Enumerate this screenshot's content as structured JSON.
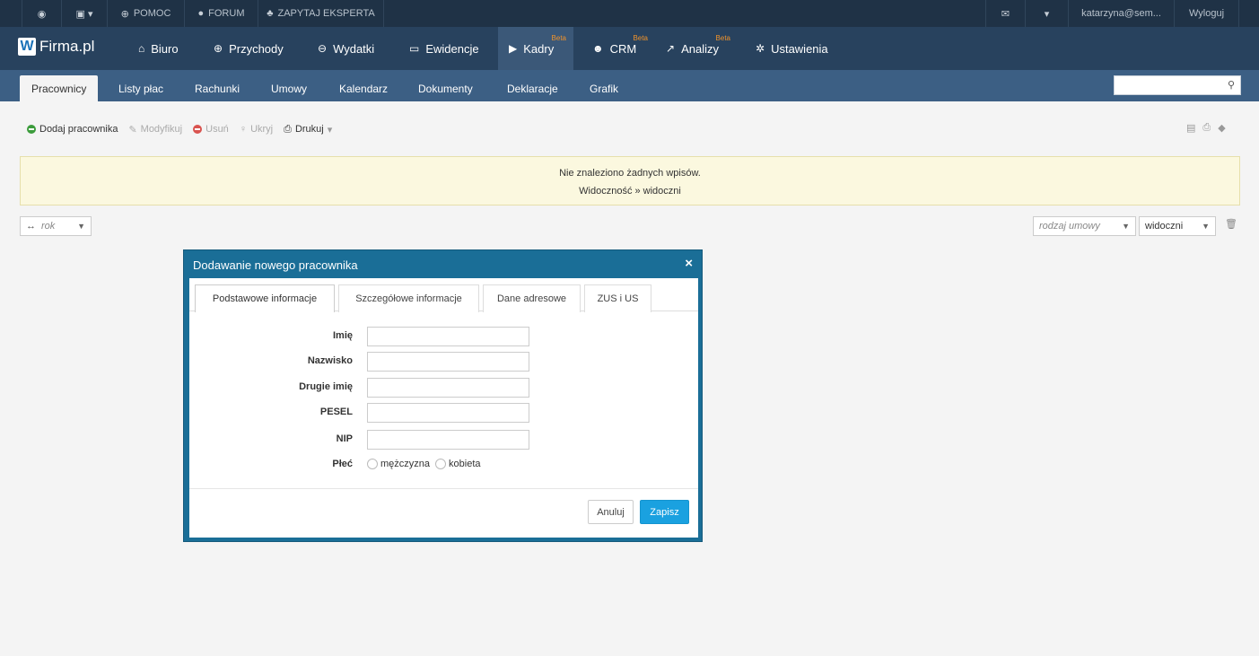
{
  "topbar": {
    "items": [
      {
        "icon": "globe-icon",
        "glyph": "◉",
        "label": ""
      },
      {
        "icon": "image-icon",
        "glyph": "▣ ▾",
        "label": ""
      },
      {
        "icon": "lifebuoy-icon",
        "glyph": "⊕",
        "label": "POMOC"
      },
      {
        "icon": "chat-icon",
        "glyph": "●",
        "label": "FORUM"
      },
      {
        "icon": "sitemap-icon",
        "glyph": "♣",
        "label": "ZAPYTAJ EKSPERTA"
      }
    ],
    "mail_glyph": "✉",
    "dropdown_glyph": "▾",
    "user": "katarzyna@sem...",
    "logout": "Wyloguj"
  },
  "brand": {
    "letter": "W",
    "name": "Firma.pl"
  },
  "mainnav": [
    {
      "label": "Biuro",
      "glyph": "⌂"
    },
    {
      "label": "Przychody",
      "glyph": "⊕"
    },
    {
      "label": "Wydatki",
      "glyph": "⊖"
    },
    {
      "label": "Ewidencje",
      "glyph": "▭"
    },
    {
      "label": "Kadry",
      "glyph": "▶",
      "badge": "Beta"
    },
    {
      "label": "CRM",
      "glyph": "☻",
      "badge": "Beta"
    },
    {
      "label": "Analizy",
      "glyph": "↗",
      "badge": "Beta"
    },
    {
      "label": "Ustawienia",
      "glyph": "✲"
    }
  ],
  "subnav": [
    "Pracownicy",
    "Listy płac",
    "Rachunki",
    "Umowy",
    "Kalendarz",
    "Dokumenty",
    "Deklaracje",
    "Grafik"
  ],
  "search": {
    "placeholder": "",
    "glyph": "⚲"
  },
  "toolbar": {
    "add": "Dodaj pracownika",
    "edit": "Modyfikuj",
    "delete": "Usuń",
    "hide": "Ukryj",
    "print": "Drukuj",
    "edit_glyph": "✎",
    "hide_glyph": "♀",
    "print_glyph": "⎙",
    "caret": "▾"
  },
  "right_icons": [
    "▤",
    "⎙",
    "◆"
  ],
  "notice": {
    "line1": "Nie znaleziono żadnych wpisów.",
    "line2": "Widoczność » widoczni"
  },
  "filters": {
    "year_icon": "↔",
    "year": "rok",
    "contract_type": "rodzaj umowy",
    "visibility": "widoczni",
    "trash_glyph": "🗑",
    "caret": "▼"
  },
  "modal": {
    "title": "Dodawanie nowego pracownika",
    "close": "×",
    "tabs": [
      "Podstawowe informacje",
      "Szczegółowe informacje",
      "Dane adresowe",
      "ZUS i US"
    ],
    "fields": [
      "Imię",
      "Nazwisko",
      "Drugie imię",
      "PESEL",
      "NIP"
    ],
    "gender_label": "Płeć",
    "gender_options": [
      "mężczyzna",
      "kobieta"
    ],
    "cancel": "Anuluj",
    "save": "Zapisz"
  }
}
